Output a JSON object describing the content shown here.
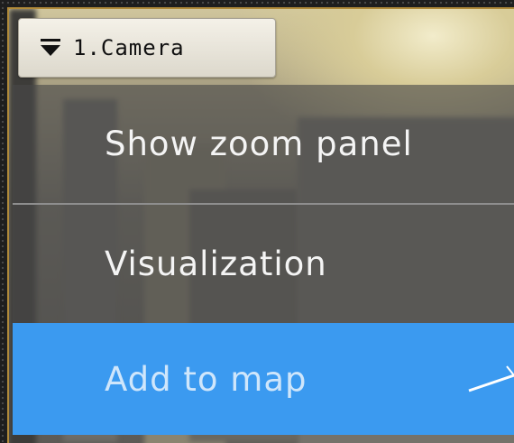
{
  "camera": {
    "title": "1.Camera",
    "icon": "collapse-menu-icon"
  },
  "menu": {
    "items": [
      {
        "label": "Show zoom panel",
        "highlighted": false
      },
      {
        "label": "Visualization",
        "highlighted": false
      },
      {
        "label": "Add to map",
        "highlighted": true
      }
    ]
  },
  "colors": {
    "tile_border": "#b08a3a",
    "highlight": "#3b9af0",
    "menu_text": "#f4f4f4"
  }
}
